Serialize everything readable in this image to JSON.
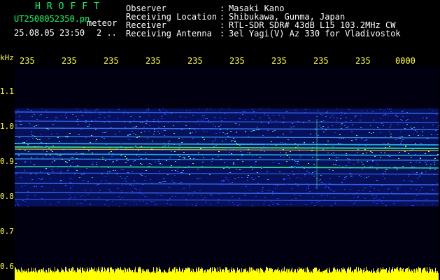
{
  "header": {
    "brand": "HROFFT",
    "filename": "UT2508052350.pn",
    "meteor_label": "meteor",
    "timestamp": "25.08.05 23:50",
    "count": "2 ..",
    "info": [
      {
        "key": "Observer",
        "value": "Masaki Kano"
      },
      {
        "key": "Receiving Location",
        "value": "Shibukawa, Gunma, Japan"
      },
      {
        "key": "Receiver",
        "value": "RTL-SDR SDR# 43dB L15 103.2MHz CW"
      },
      {
        "key": "Receiving Antenna",
        "value": "3el Yagi(V) Az 330 for Vladivostok"
      }
    ],
    "separator": ":"
  },
  "axis": {
    "y_unit": "kHz",
    "y_ticks": [
      "1.1",
      "1.0",
      "0.9",
      "0.8",
      "0.7",
      "0.6"
    ],
    "x_ticks": [
      "235",
      "235",
      "235",
      "235",
      "235",
      "235",
      "235",
      "235",
      "235",
      "0000"
    ]
  },
  "colors": {
    "background": "#000000",
    "plot_bg": "#000010",
    "header_green": "#00ff66",
    "header_white": "#ffffff",
    "tick_yellow": "#ffff33",
    "level_yellow": "#ffff00"
  }
}
